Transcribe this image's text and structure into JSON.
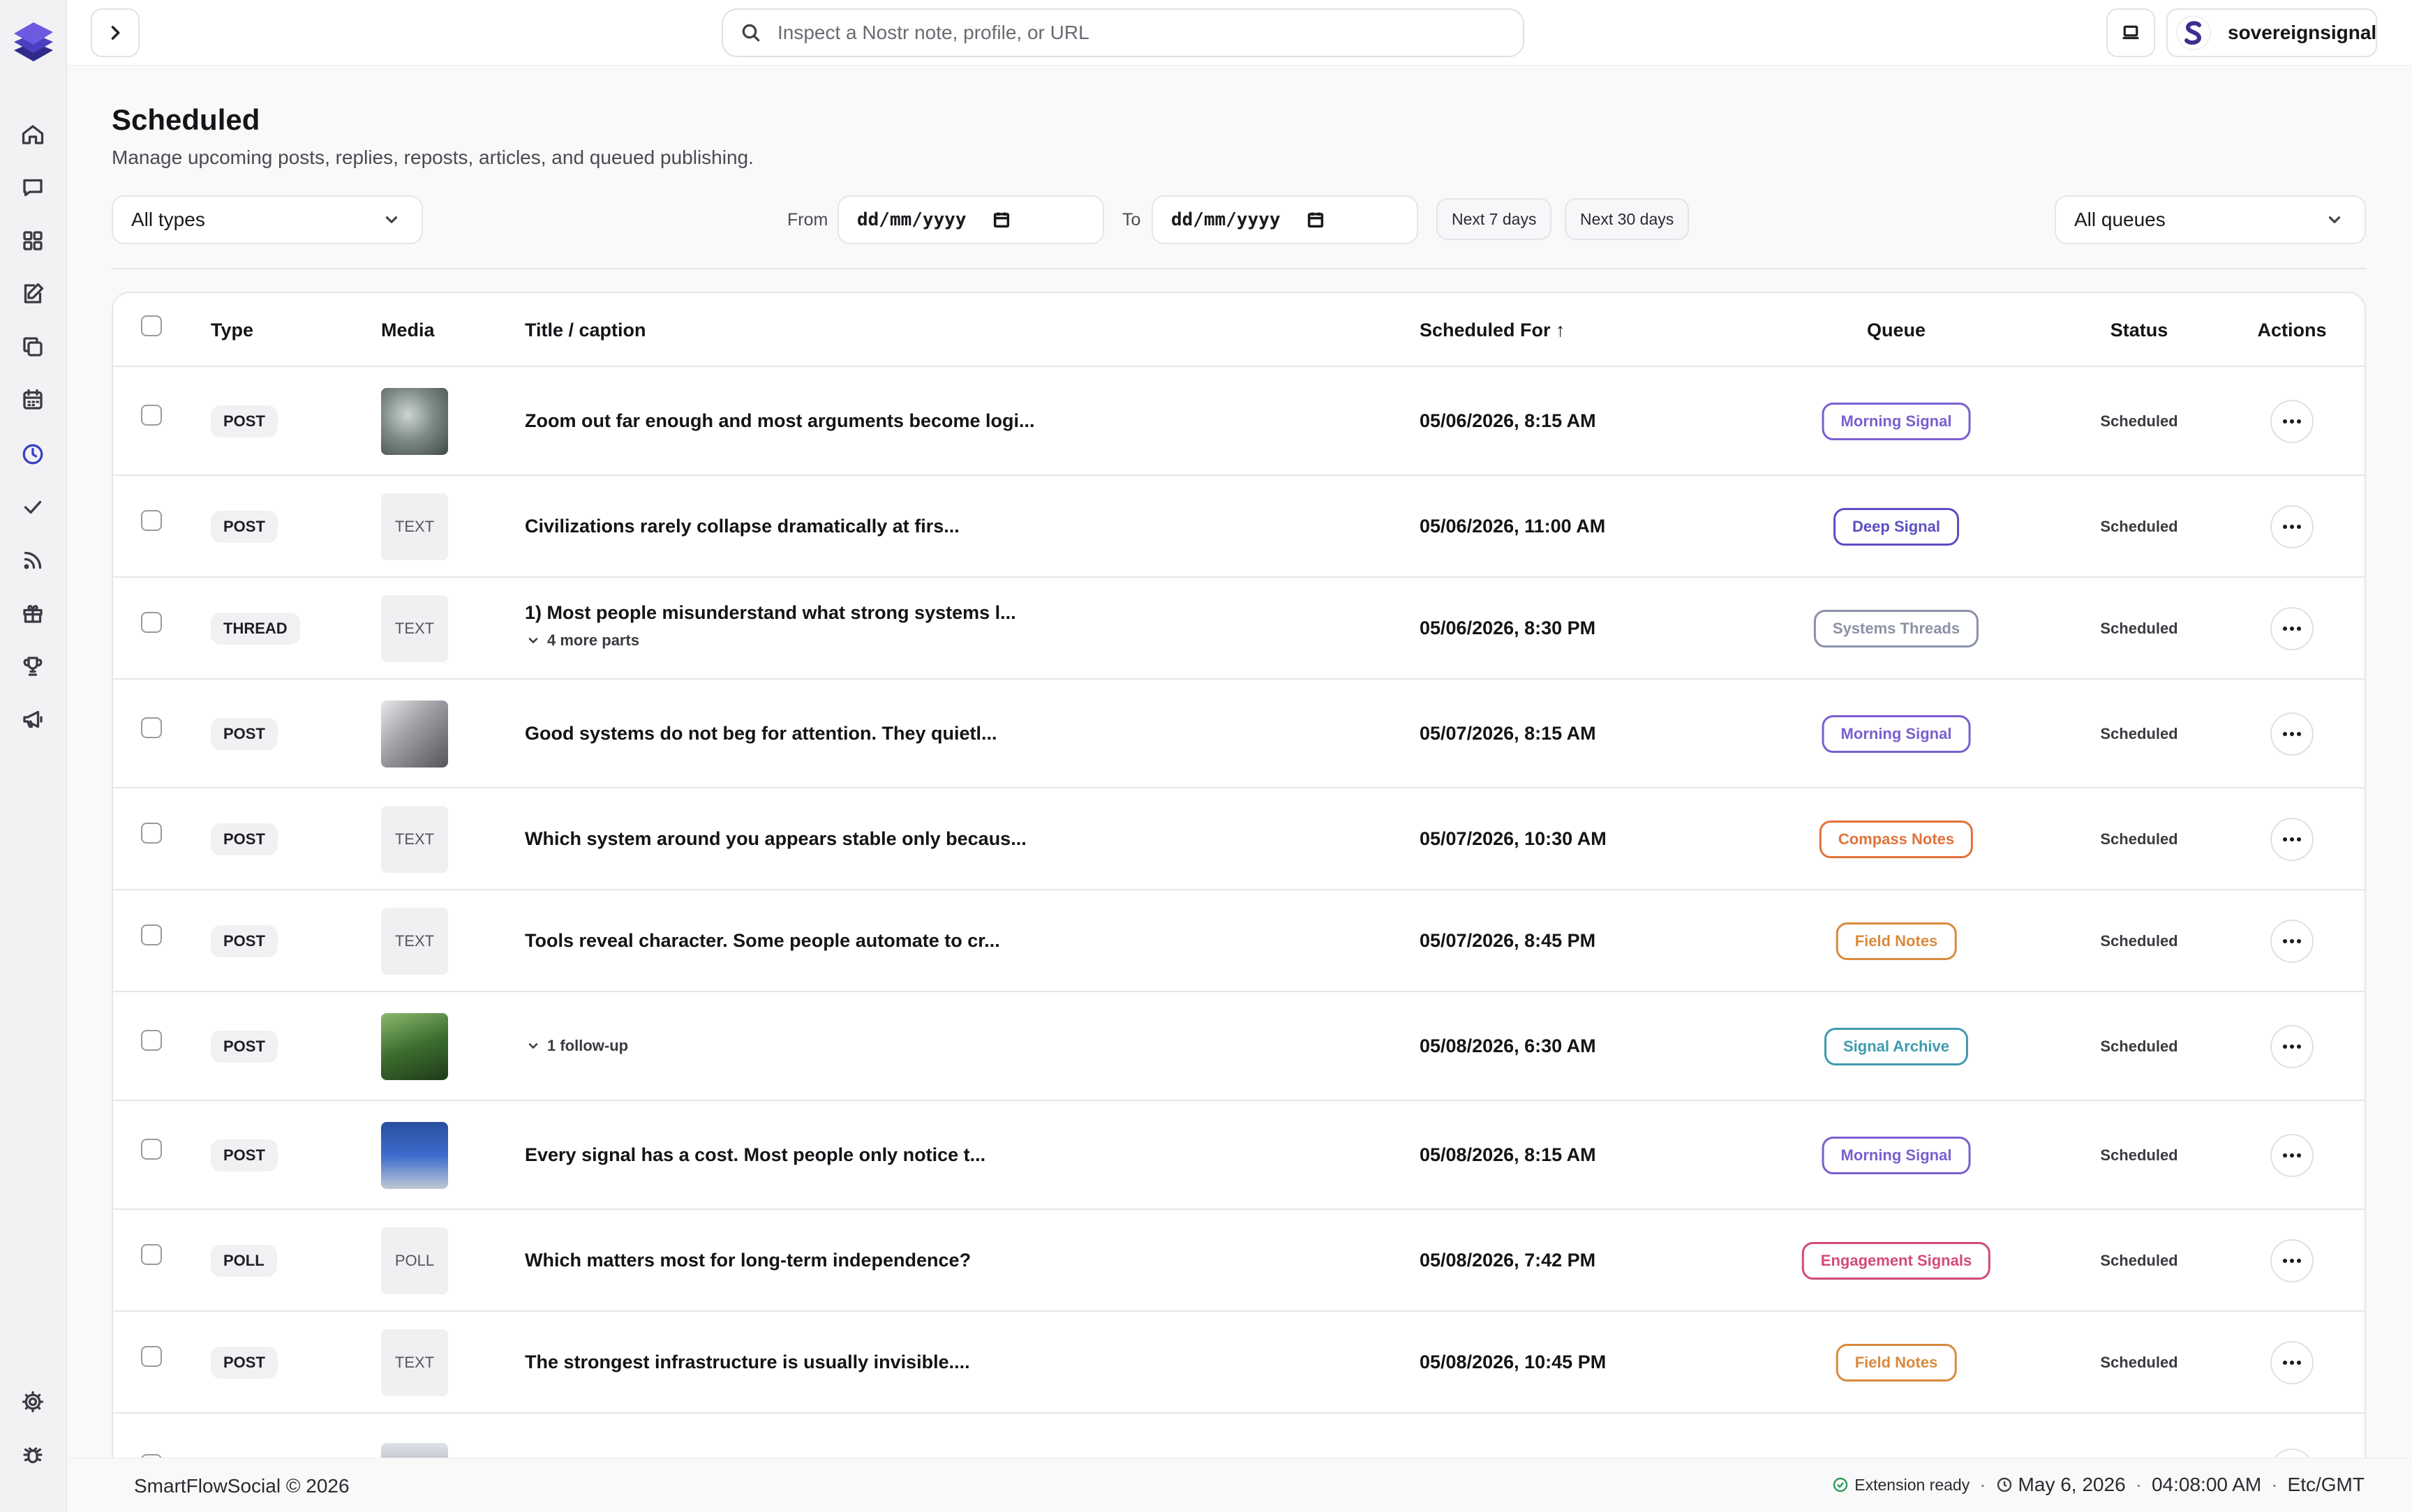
{
  "app": {
    "footer_brand": "SmartFlowSocial © 2026"
  },
  "search": {
    "placeholder": "Inspect a Nostr note, profile, or URL"
  },
  "account": {
    "name": "sovereignsignal"
  },
  "page": {
    "title": "Scheduled",
    "subtitle": "Manage upcoming posts, replies, reposts, articles, and queued publishing."
  },
  "filters": {
    "type_select": "All types",
    "from_label": "From",
    "to_label": "To",
    "from_value": "dd/mm/yyyy",
    "to_value": "dd/mm/yyyy",
    "next7": "Next 7 days",
    "next30": "Next 30 days",
    "queue_select": "All queues"
  },
  "table": {
    "headers": {
      "type": "Type",
      "media": "Media",
      "title": "Title / caption",
      "scheduled": "Scheduled For ↑",
      "queue": "Queue",
      "status": "Status",
      "actions": "Actions"
    },
    "rows": [
      {
        "type": "POST",
        "media": "image",
        "media_label": "",
        "title": "Zoom out far enough and most arguments become logi...",
        "sub": "",
        "scheduled": "05/06/2026, 8:15 AM",
        "queue": "Morning Signal",
        "queue_color": "#7a5fd0",
        "status": "Scheduled"
      },
      {
        "type": "POST",
        "media": "text",
        "media_label": "TEXT",
        "title": "Civilizations rarely collapse dramatically at firs...",
        "sub": "",
        "scheduled": "05/06/2026, 11:00 AM",
        "queue": "Deep Signal",
        "queue_color": "#5b4fc4",
        "status": "Scheduled"
      },
      {
        "type": "THREAD",
        "media": "text",
        "media_label": "TEXT",
        "title": "1) Most people misunderstand what strong systems l...",
        "sub": "4 more parts",
        "scheduled": "05/06/2026, 8:30 PM",
        "queue": "Systems Threads",
        "queue_color": "#8a92a6",
        "status": "Scheduled"
      },
      {
        "type": "POST",
        "media": "image",
        "media_label": "",
        "title": "Good systems do not beg for attention. They quietl...",
        "sub": "",
        "scheduled": "05/07/2026, 8:15 AM",
        "queue": "Morning Signal",
        "queue_color": "#7a5fd0",
        "status": "Scheduled"
      },
      {
        "type": "POST",
        "media": "text",
        "media_label": "TEXT",
        "title": "Which system around you appears stable only becaus...",
        "sub": "",
        "scheduled": "05/07/2026, 10:30 AM",
        "queue": "Compass Notes",
        "queue_color": "#e0733a",
        "status": "Scheduled"
      },
      {
        "type": "POST",
        "media": "text",
        "media_label": "TEXT",
        "title": "Tools reveal character. Some people automate to cr...",
        "sub": "",
        "scheduled": "05/07/2026, 8:45 PM",
        "queue": "Field Notes",
        "queue_color": "#d98a3c",
        "status": "Scheduled"
      },
      {
        "type": "POST",
        "media": "image",
        "media_label": "",
        "title": "",
        "sub": "1 follow-up",
        "scheduled": "05/08/2026, 6:30 AM",
        "queue": "Signal Archive",
        "queue_color": "#3f9bb0",
        "status": "Scheduled"
      },
      {
        "type": "POST",
        "media": "image",
        "media_label": "",
        "title": "Every signal has a cost. Most people only notice t...",
        "sub": "",
        "scheduled": "05/08/2026, 8:15 AM",
        "queue": "Morning Signal",
        "queue_color": "#7a5fd0",
        "status": "Scheduled"
      },
      {
        "type": "POLL",
        "media": "text",
        "media_label": "POLL",
        "title": "Which matters most for long-term independence?",
        "sub": "",
        "scheduled": "05/08/2026, 7:42 PM",
        "queue": "Engagement Signals",
        "queue_color": "#d24a7a",
        "status": "Scheduled"
      },
      {
        "type": "POST",
        "media": "text",
        "media_label": "TEXT",
        "title": "The strongest infrastructure is usually invisible....",
        "sub": "",
        "scheduled": "05/08/2026, 10:45 PM",
        "queue": "Field Notes",
        "queue_color": "#d98a3c",
        "status": "Scheduled"
      }
    ]
  },
  "footer": {
    "extension": "Extension ready",
    "date": "May 6, 2026",
    "time": "04:08:00 AM",
    "tz": "Etc/GMT"
  },
  "icons": {
    "rail": [
      "home-icon",
      "messages-icon",
      "dashboard-icon",
      "compose-icon",
      "copy-icon",
      "calendar-icon",
      "clock-icon",
      "check-icon",
      "rss-icon",
      "gift-icon",
      "trophy-icon",
      "megaphone-icon"
    ],
    "rail_bottom": [
      "settings-icon",
      "bug-icon"
    ]
  },
  "colors": {
    "accent": "#3a3fc4",
    "brand": "#5b3fd0"
  }
}
